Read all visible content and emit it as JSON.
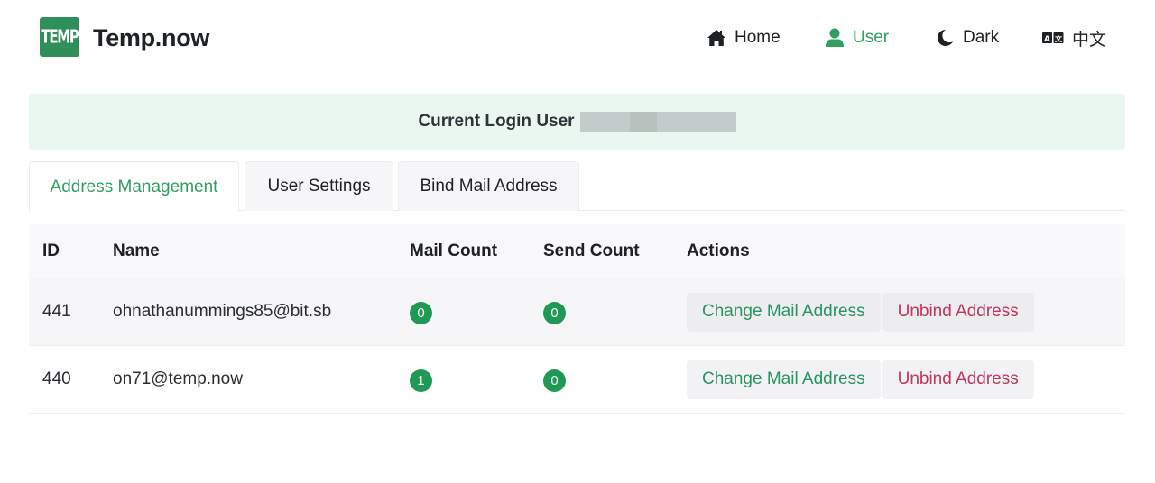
{
  "header": {
    "logo_text": "TEMP",
    "brand": "Temp.now",
    "nav": [
      {
        "label": "Home",
        "icon": "home-icon"
      },
      {
        "label": "User",
        "icon": "user-icon",
        "active": true
      },
      {
        "label": "Dark",
        "icon": "moon-icon"
      },
      {
        "label": "中文",
        "icon": "translate-icon"
      }
    ]
  },
  "banner": {
    "label": "Current Login User",
    "value_masked": true
  },
  "tabs": [
    {
      "label": "Address Management",
      "active": true
    },
    {
      "label": "User Settings"
    },
    {
      "label": "Bind Mail Address"
    }
  ],
  "table": {
    "columns": [
      "ID",
      "Name",
      "Mail Count",
      "Send Count",
      "Actions"
    ],
    "rows": [
      {
        "id": "441",
        "name": "ohnathanummings85@bit.sb",
        "mail_count": "0",
        "send_count": "0",
        "actions": [
          "Change Mail Address",
          "Unbind Address"
        ]
      },
      {
        "id": "440",
        "name": "on71@temp.now",
        "mail_count": "1",
        "send_count": "0",
        "actions": [
          "Change Mail Address",
          "Unbind Address"
        ]
      }
    ]
  },
  "colors": {
    "accent": "#2fa062",
    "logo_bg": "#2f8f5b",
    "badge": "#1f9a55",
    "danger": "#c0385a",
    "banner_bg": "#eaf6f0"
  }
}
